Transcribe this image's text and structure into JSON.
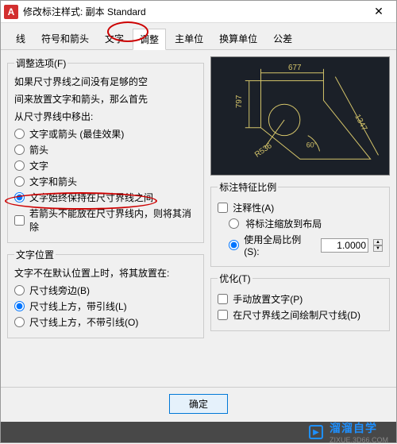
{
  "window": {
    "title": "修改标注样式: 副本 Standard",
    "close": "✕",
    "logo": "A"
  },
  "tabs": {
    "items": [
      {
        "label": "线"
      },
      {
        "label": "符号和箭头"
      },
      {
        "label": "文字"
      },
      {
        "label": "调整"
      },
      {
        "label": "主单位"
      },
      {
        "label": "换算单位"
      },
      {
        "label": "公差"
      }
    ]
  },
  "fit_options": {
    "legend": "调整选项(F)",
    "desc1": "如果尺寸界线之间没有足够的空",
    "desc2": "间来放置文字和箭头，那么首先",
    "desc3": "从尺寸界线中移出:",
    "r1": "文字或箭头 (最佳效果)",
    "r2": "箭头",
    "r3": "文字",
    "r4": "文字和箭头",
    "r5": "文字始终保持在尺寸界线之间",
    "c1": "若箭头不能放在尺寸界线内，则将其消除"
  },
  "text_pos": {
    "legend": "文字位置",
    "desc": "文字不在默认位置上时，将其放置在:",
    "r1": "尺寸线旁边(B)",
    "r2": "尺寸线上方，带引线(L)",
    "r3": "尺寸线上方，不带引线(O)"
  },
  "preview": {
    "d1": "677",
    "d2": "797",
    "d3": "1347",
    "d4": "R536",
    "d5": "60°"
  },
  "scale": {
    "legend": "标注特征比例",
    "c_annot": "注释性(A)",
    "r_layout": "将标注缩放到布局",
    "r_global": "使用全局比例(S):",
    "value": "1.0000"
  },
  "optimize": {
    "legend": "优化(T)",
    "c1": "手动放置文字(P)",
    "c2": "在尺寸界线之间绘制尺寸线(D)"
  },
  "buttons": {
    "ok": "确定"
  },
  "watermark": {
    "brand": "溜溜自学",
    "url": "ZIXUE.3D66.COM",
    "icon": "▶"
  }
}
